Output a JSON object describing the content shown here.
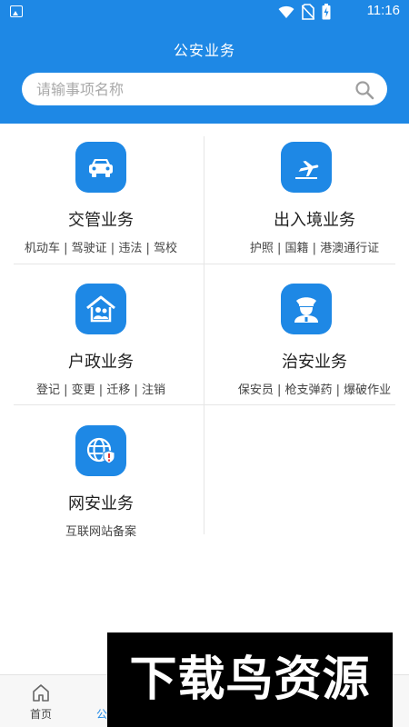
{
  "statusbar": {
    "time": "11:16"
  },
  "header": {
    "title": "公安业务"
  },
  "search": {
    "placeholder": "请输事项名称"
  },
  "services": [
    {
      "title": "交管业务",
      "sub": "机动车 | 驾驶证 | 违法 | 驾校",
      "icon": "car-icon"
    },
    {
      "title": "出入境业务",
      "sub": "护照 | 国籍 | 港澳通行证",
      "icon": "airplane-icon"
    },
    {
      "title": "户政业务",
      "sub": "登记 | 变更 | 迁移 | 注销",
      "icon": "household-icon"
    },
    {
      "title": "治安业务",
      "sub": "保安员 | 枪支弹药 | 爆破作业",
      "icon": "police-officer-icon"
    },
    {
      "title": "网安业务",
      "sub": "互联网站备案",
      "icon": "globe-shield-icon"
    }
  ],
  "tabbar": {
    "home_label": "首页",
    "police_label": "公"
  },
  "watermark": {
    "text": "下载鸟资源"
  },
  "colors": {
    "primary": "#1e88e5"
  }
}
